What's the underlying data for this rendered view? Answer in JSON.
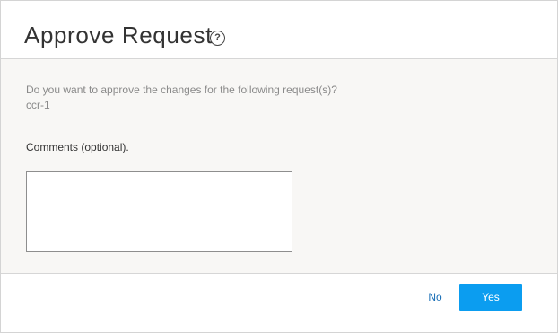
{
  "dialog": {
    "title": "Approve Request",
    "help_icon": "help-circle-icon",
    "help_glyph": "?"
  },
  "body": {
    "question": "Do you want to approve the changes for the following request(s)?",
    "request_id": "ccr-1",
    "comments_label": "Comments (optional).",
    "comments_value": "",
    "comments_placeholder": ""
  },
  "footer": {
    "no_label": "No",
    "yes_label": "Yes"
  },
  "colors": {
    "primary_button": "#0b9df0",
    "link_button": "#1a6fb7",
    "body_background": "#f8f7f5"
  }
}
